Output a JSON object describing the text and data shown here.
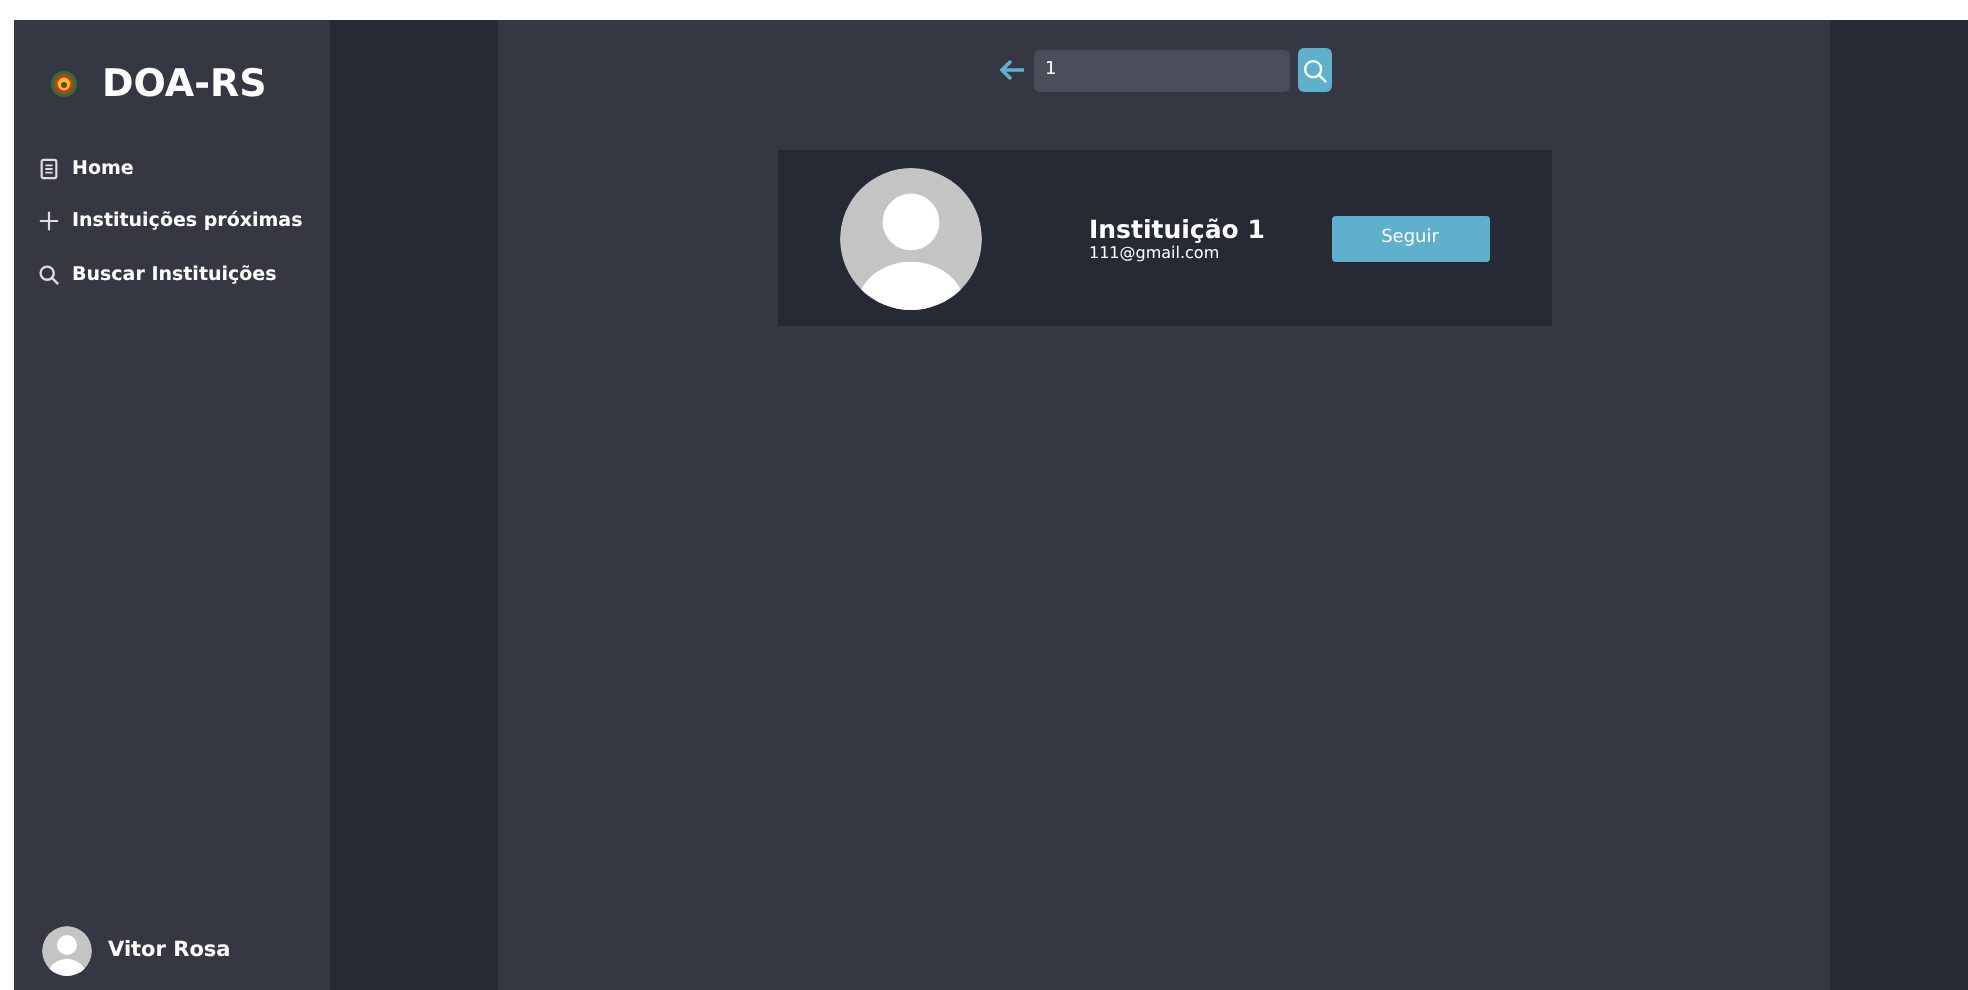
{
  "sidebar": {
    "brand": "DOA-RS",
    "items": [
      {
        "kind": "home",
        "label": "Home"
      },
      {
        "kind": "plus",
        "label": "Instituições próximas"
      },
      {
        "kind": "search",
        "label": "Buscar Instituições"
      }
    ],
    "user": {
      "name": "Vitor Rosa"
    }
  },
  "search": {
    "value": "1"
  },
  "results": [
    {
      "name": "Instituição 1",
      "email": "111@gmail.com",
      "button": "Seguir"
    }
  ]
}
